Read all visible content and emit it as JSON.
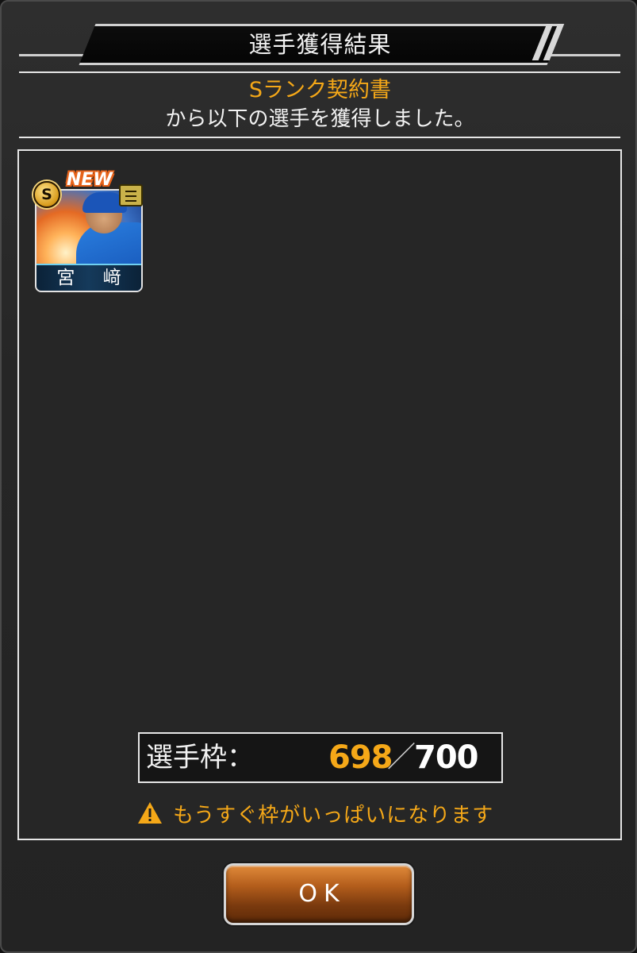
{
  "dialog": {
    "title": "選手獲得結果",
    "source_item": "Sランク契約書",
    "message": "から以下の選手を獲得しました。"
  },
  "players": [
    {
      "name": "宮 﨑",
      "rank": "S",
      "new_label": "NEW"
    }
  ],
  "roster": {
    "label": "選手枠：",
    "current": "698",
    "separator": "／",
    "max": "700",
    "warning": "もうすぐ枠がいっぱいになります",
    "warning_color": "#f5a818"
  },
  "actions": {
    "ok_label": "OK"
  },
  "icons": {
    "rank_badge": "s-rank-badge-icon",
    "menu": "hamburger-menu-icon",
    "warning": "warning-triangle-icon"
  }
}
